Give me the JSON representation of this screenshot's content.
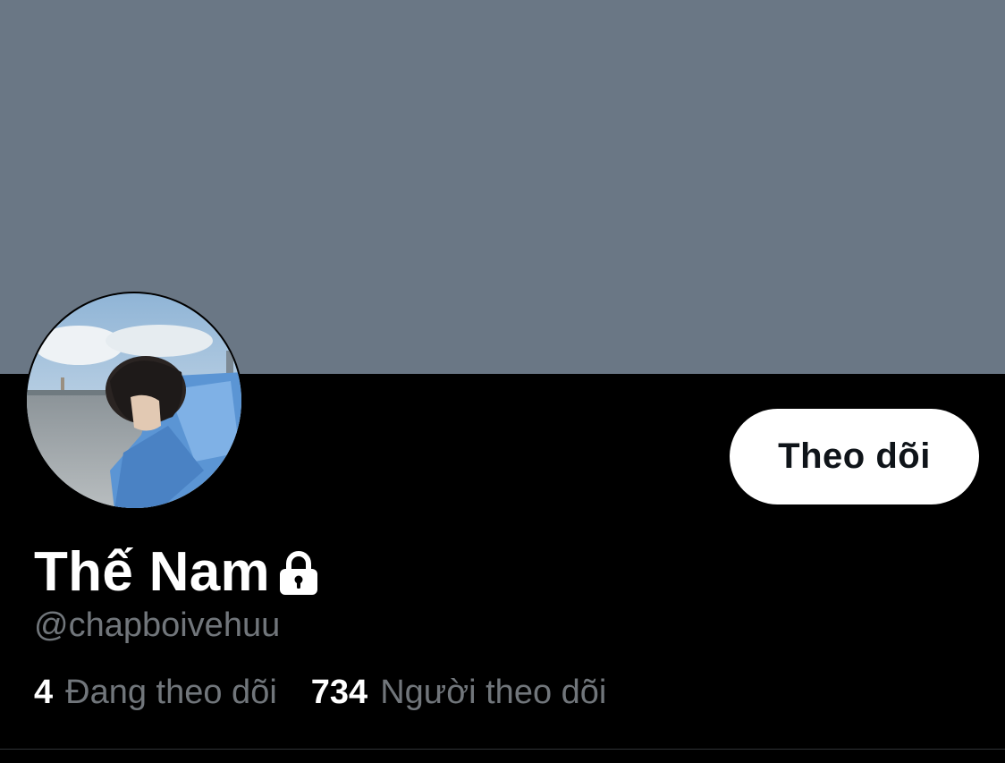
{
  "profile": {
    "display_name": "Thế Nam",
    "handle": "@chapboivehuu",
    "protected_icon": "lock-icon",
    "avatar_alt": "profile photo"
  },
  "actions": {
    "follow_label": "Theo dõi"
  },
  "stats": {
    "following_count": "4",
    "following_label": "Đang theo dõi",
    "followers_count": "734",
    "followers_label": "Người theo dõi"
  },
  "colors": {
    "banner": "#6a7785",
    "background": "#000000",
    "secondary_text": "#71767b",
    "button_bg": "#ffffff",
    "button_text": "#0f1419"
  }
}
